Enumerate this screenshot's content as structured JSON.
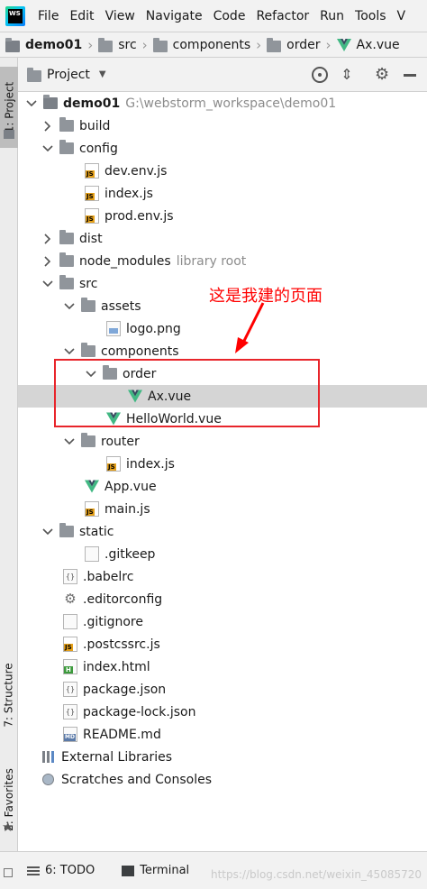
{
  "menubar": {
    "items": [
      "File",
      "Edit",
      "View",
      "Navigate",
      "Code",
      "Refactor",
      "Run",
      "Tools",
      "V"
    ]
  },
  "breadcrumb": [
    "demo01",
    "src",
    "components",
    "order",
    "Ax.vue"
  ],
  "left_tabs": {
    "project": "1: Project",
    "structure": "7: Structure",
    "favorites": "2: Favorites"
  },
  "project_panel": {
    "title": "Project"
  },
  "tree": [
    {
      "name": "demo01",
      "hint": "G:\\webstorm_workspace\\demo01",
      "type": "root"
    },
    {
      "name": "build",
      "type": "folder"
    },
    {
      "name": "config",
      "type": "folder"
    },
    {
      "name": "dev.env.js",
      "type": "js"
    },
    {
      "name": "index.js",
      "type": "js"
    },
    {
      "name": "prod.env.js",
      "type": "js"
    },
    {
      "name": "dist",
      "type": "folder"
    },
    {
      "name": "node_modules",
      "hint": "library root",
      "type": "folder"
    },
    {
      "name": "src",
      "type": "folder"
    },
    {
      "name": "assets",
      "type": "folder"
    },
    {
      "name": "logo.png",
      "type": "image"
    },
    {
      "name": "components",
      "type": "folder"
    },
    {
      "name": "order",
      "type": "folder"
    },
    {
      "name": "Ax.vue",
      "type": "vue"
    },
    {
      "name": "HelloWorld.vue",
      "type": "vue"
    },
    {
      "name": "router",
      "type": "folder"
    },
    {
      "name": "index.js",
      "type": "js"
    },
    {
      "name": "App.vue",
      "type": "vue"
    },
    {
      "name": "main.js",
      "type": "js"
    },
    {
      "name": "static",
      "type": "folder"
    },
    {
      "name": ".gitkeep",
      "type": "file"
    },
    {
      "name": ".babelrc",
      "type": "config"
    },
    {
      "name": ".editorconfig",
      "type": "gear"
    },
    {
      "name": ".gitignore",
      "type": "file"
    },
    {
      "name": ".postcssrc.js",
      "type": "js"
    },
    {
      "name": "index.html",
      "type": "html"
    },
    {
      "name": "package.json",
      "type": "config"
    },
    {
      "name": "package-lock.json",
      "type": "config"
    },
    {
      "name": "README.md",
      "type": "md"
    },
    {
      "name": "External Libraries",
      "type": "libraries"
    },
    {
      "name": "Scratches and Consoles",
      "type": "scratches"
    }
  ],
  "annotation": "这是我建的页面",
  "bottom_tabs": {
    "todo": "6: TODO",
    "terminal": "Terminal"
  },
  "watermark": "https://blog.csdn.net/weixin_45085720",
  "colors": {
    "vue_green": "#41b883",
    "vue_dark": "#35495e",
    "annotation_red": "#ff0000",
    "selection": "#d5d5d5"
  }
}
